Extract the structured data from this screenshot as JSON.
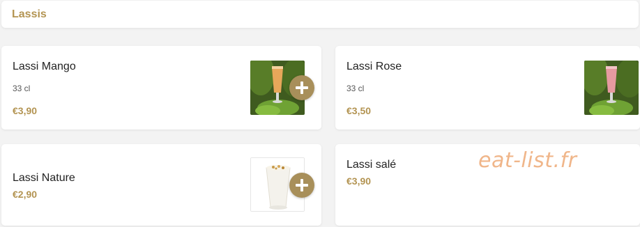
{
  "section": {
    "title": "Lassis"
  },
  "items": [
    {
      "name": "Lassi Mango",
      "desc": "33 cl",
      "price": "€3,90",
      "image_icon": "mango-lassi-photo-icon"
    },
    {
      "name": "Lassi Rose",
      "desc": "33 cl",
      "price": "€3,50",
      "image_icon": "rose-lassi-photo-icon"
    },
    {
      "name": "Lassi Nature",
      "desc": "",
      "price": "€2,90",
      "image_icon": "plain-lassi-photo-icon"
    },
    {
      "name": "Lassi salé",
      "desc": "",
      "price": "€3,90"
    }
  ],
  "watermark": "eat-list.fr",
  "colors": {
    "accent": "#b39452",
    "button": "#a88f5a",
    "watermark": "#f0b68a"
  }
}
